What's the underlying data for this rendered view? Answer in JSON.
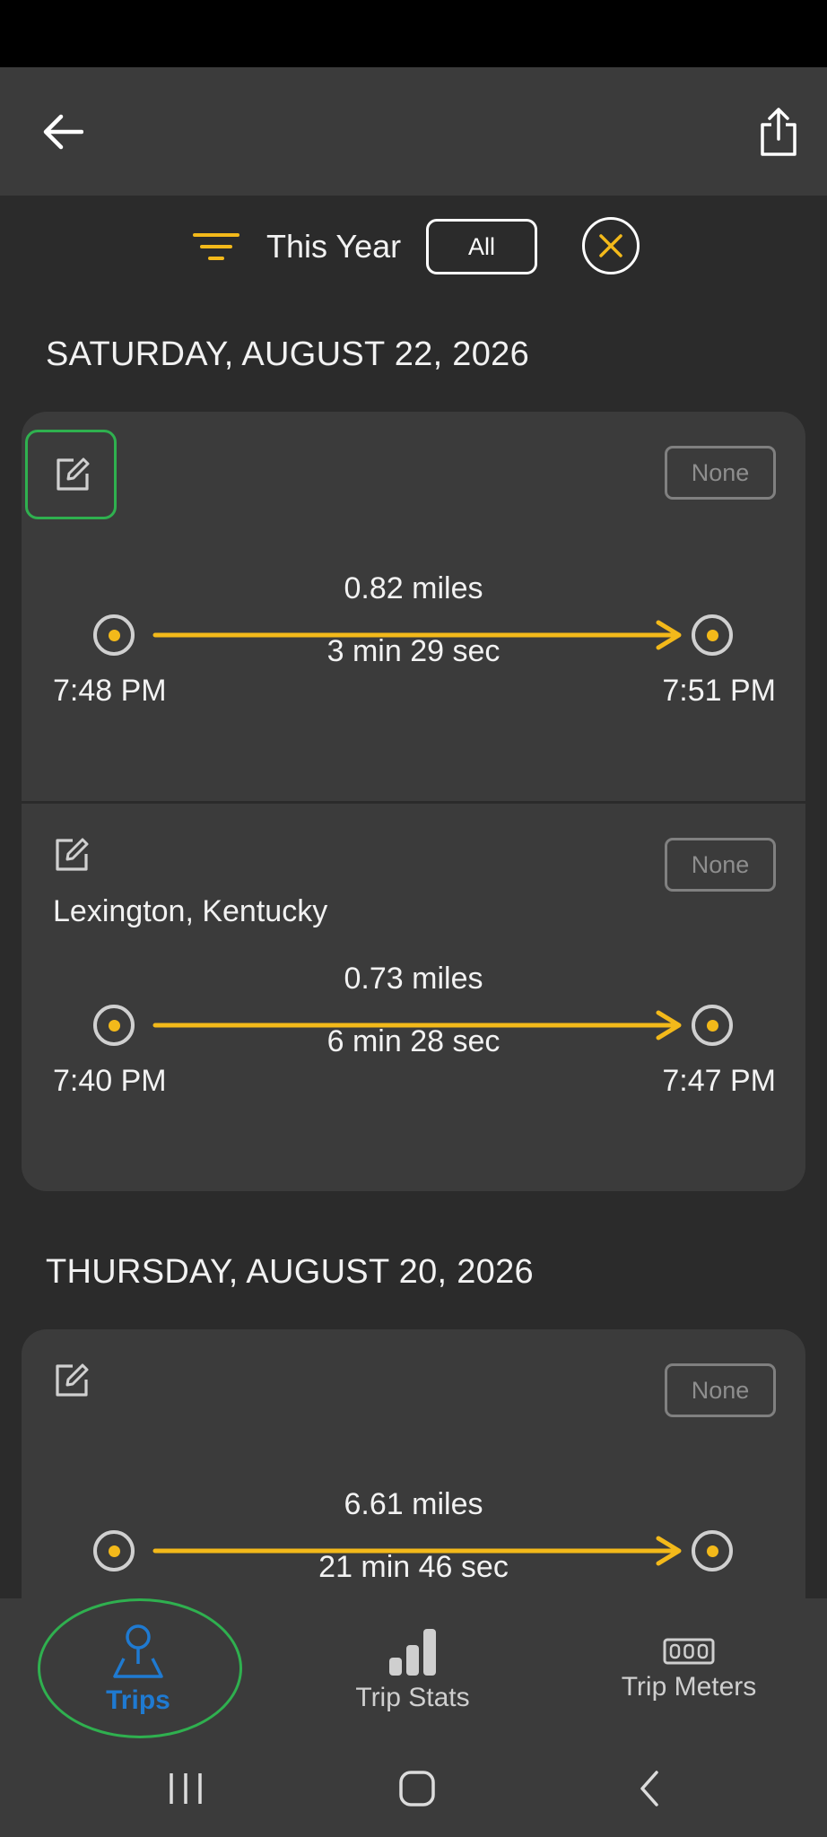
{
  "filter": {
    "label": "This Year",
    "all_button": "All"
  },
  "days": [
    {
      "header": "SATURDAY, AUGUST 22, 2026",
      "trips": [
        {
          "tag": "None",
          "location": "",
          "distance": "0.82 miles",
          "duration": "3 min 29 sec",
          "start_time": "7:48 PM",
          "end_time": "7:51 PM"
        },
        {
          "tag": "None",
          "location": "Lexington, Kentucky",
          "distance": "0.73 miles",
          "duration": "6 min 28 sec",
          "start_time": "7:40 PM",
          "end_time": "7:47 PM"
        }
      ]
    },
    {
      "header": "THURSDAY, AUGUST 20, 2026",
      "trips": [
        {
          "tag": "None",
          "location": "",
          "distance": "6.61 miles",
          "duration": "21 min 46 sec",
          "start_time": "",
          "end_time": ""
        }
      ]
    }
  ],
  "bottom_nav": {
    "trips": "Trips",
    "trip_stats": "Trip Stats",
    "trip_meters": "Trip Meters"
  },
  "colors": {
    "accent": "#f3b91a",
    "active_nav": "#1f7ad1",
    "highlight": "#2fb04f"
  },
  "icons": [
    "back-arrow-icon",
    "share-icon",
    "filter-icon",
    "close-icon",
    "edit-icon",
    "trip-pin-icon",
    "bar-chart-icon",
    "meter-icon"
  ]
}
